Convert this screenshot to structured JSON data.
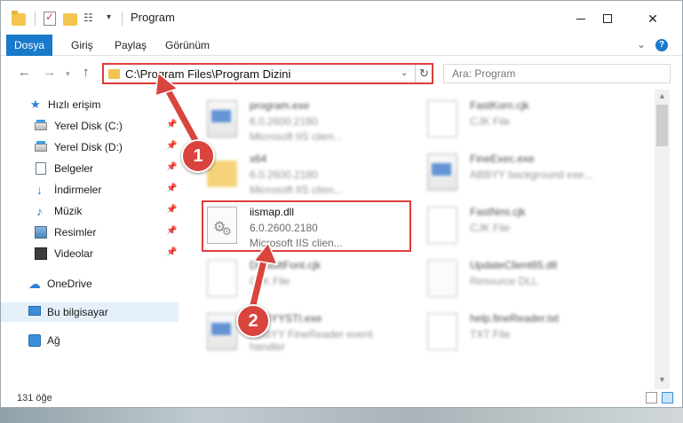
{
  "window": {
    "title": "Program"
  },
  "ribbon": {
    "tabs": [
      {
        "label": "Dosya"
      },
      {
        "label": "Giriş"
      },
      {
        "label": "Paylaş"
      },
      {
        "label": "Görünüm"
      }
    ],
    "help_label": "?"
  },
  "nav": {
    "address": "C:\\Program Files\\Program Dizini",
    "search_placeholder": "Ara: Program"
  },
  "sidebar": {
    "items": [
      {
        "label": "Hızlı erişim",
        "icon": "star-icon"
      },
      {
        "label": "Yerel Disk (C:)",
        "icon": "disk-icon"
      },
      {
        "label": "Yerel Disk (D:)",
        "icon": "disk-icon"
      },
      {
        "label": "Belgeler",
        "icon": "document-icon"
      },
      {
        "label": "İndirmeler",
        "icon": "download-icon"
      },
      {
        "label": "Müzik",
        "icon": "music-icon"
      },
      {
        "label": "Resimler",
        "icon": "pictures-icon"
      },
      {
        "label": "Videolar",
        "icon": "video-icon"
      },
      {
        "label": "OneDrive",
        "icon": "cloud-icon"
      },
      {
        "label": "Bu bilgisayar",
        "icon": "computer-icon"
      },
      {
        "label": "Ağ",
        "icon": "network-icon"
      }
    ]
  },
  "files": [
    {
      "name": "program.exe",
      "version": "6.0.2600.2180",
      "desc": "Microsoft IIS clien...",
      "icon": "exe-icon"
    },
    {
      "name": "FastKorn.cjk",
      "version": "CJK File",
      "desc": "",
      "icon": "page-icon"
    },
    {
      "name": "x64",
      "version": "6.0.2600.2180",
      "desc": "Microsoft IIS clien...",
      "icon": "folder-icon"
    },
    {
      "name": "FineExec.exe",
      "version": "ABBYY background exe...",
      "desc": "",
      "icon": "exe-icon"
    },
    {
      "name": "iismap.dll",
      "version": "6.0.2600.2180",
      "desc": "Microsoft IIS clien...",
      "icon": "dll-icon"
    },
    {
      "name": "FastNmi.cjk",
      "version": "CJK File",
      "desc": "",
      "icon": "page-icon"
    },
    {
      "name": "DefaultFont.cjk",
      "version": "CJK File",
      "desc": "",
      "icon": "page-icon"
    },
    {
      "name": "UpdateClient65.dll",
      "version": "Resource DLL",
      "desc": "",
      "icon": "dll-icon"
    },
    {
      "name": "ABBYYSTI.exe",
      "version": "ABBYY FineReader event handler",
      "desc": "",
      "icon": "exe-icon"
    },
    {
      "name": "help.fineReader.txt",
      "version": "TXT File",
      "desc": "",
      "icon": "page-icon"
    }
  ],
  "status": {
    "count": "131 öğe"
  },
  "annotations": {
    "marker1": "1",
    "marker2": "2",
    "color": "#d9443d"
  }
}
